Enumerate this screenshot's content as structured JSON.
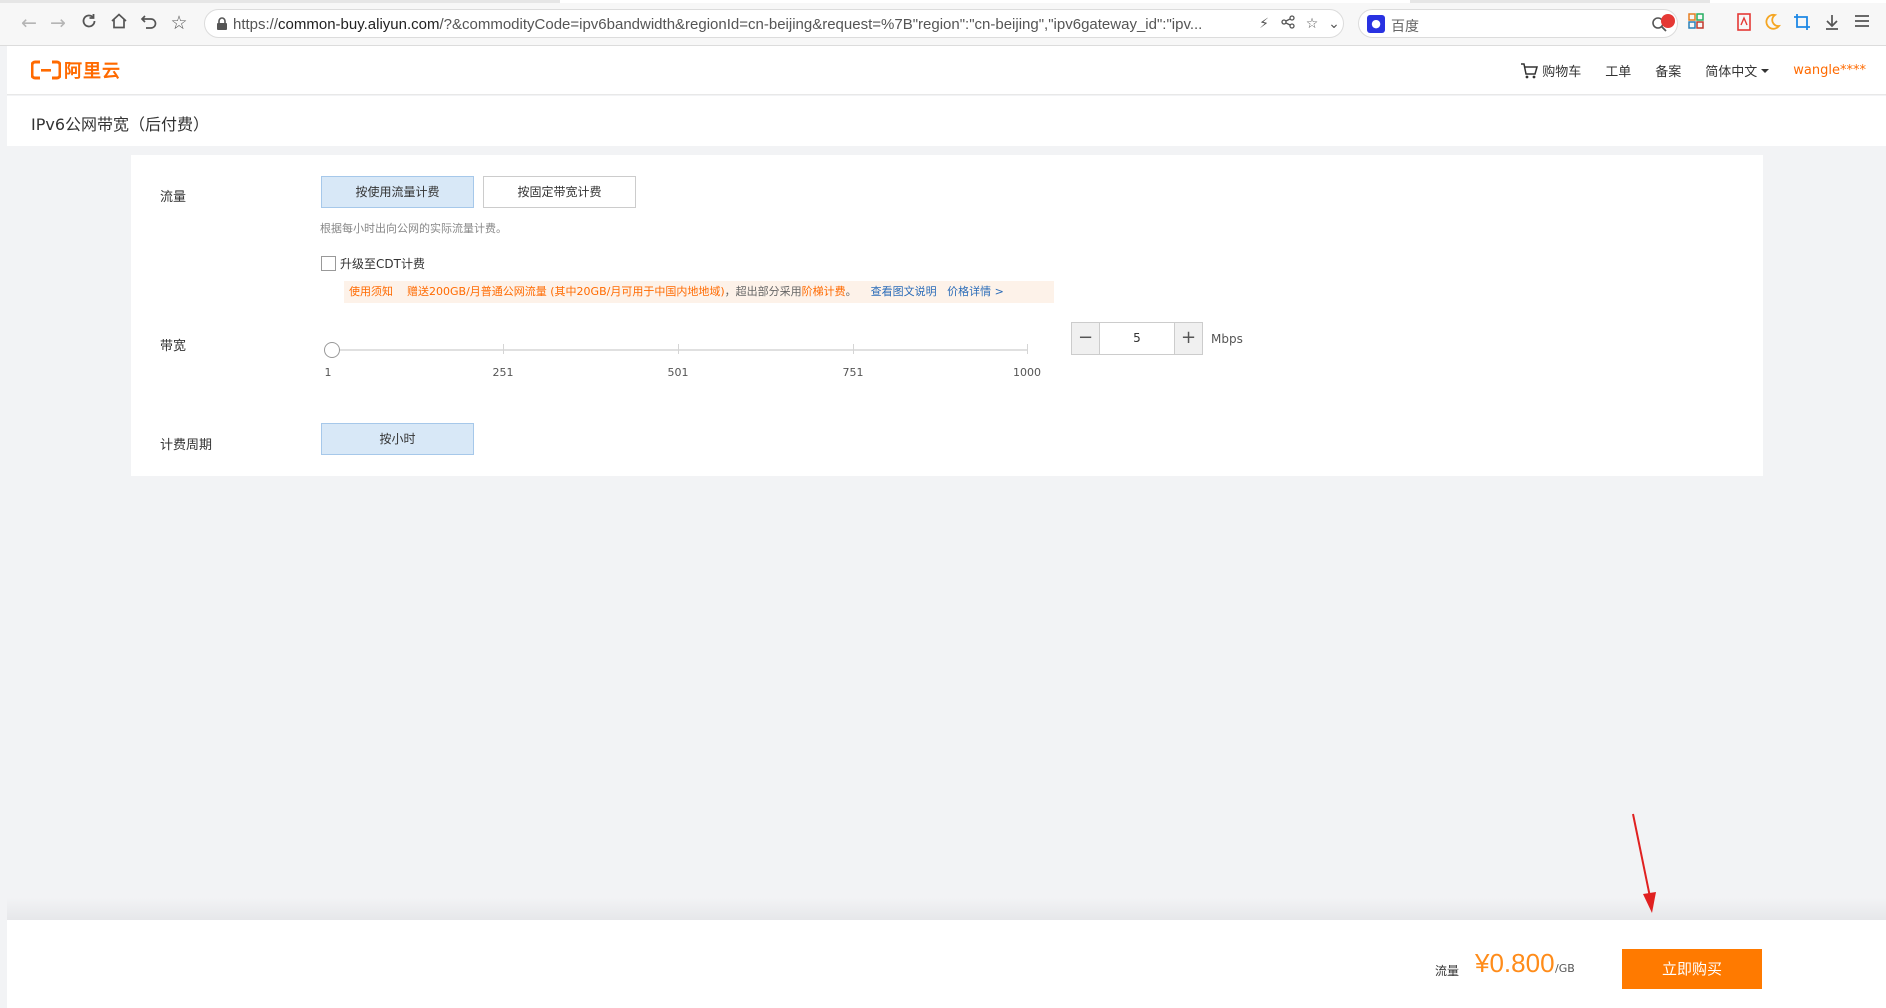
{
  "browser": {
    "url_prefix": "https://",
    "url_host": "common-buy.aliyun.com",
    "url_rest": "/?&commodityCode=ipv6bandwidth&regionId=cn-beijing&request=%7B\"region\":\"cn-beijing\",\"ipv6gateway_id\":\"ipv...",
    "search_engine": "百度"
  },
  "header": {
    "logo_text": "阿里云",
    "cart_label": "购物车",
    "ticket_label": "工单",
    "filing_label": "备案",
    "language_label": "简体中文",
    "user_label": "wangle****"
  },
  "page": {
    "title": "IPv6公网带宽（后付费）"
  },
  "traffic": {
    "label": "流量",
    "option_usage": "按使用流量计费",
    "option_fixed": "按固定带宽计费",
    "hint": "根据每小时出向公网的实际流量计费。",
    "cdt_label": "升级至CDT计费",
    "notice_title": "使用须知",
    "notice_gift": "赠送200GB/月普通公网流量 (其中20GB/月可用于中国内地地域)",
    "notice_mid": "，超出部分采用",
    "notice_tier": "阶梯计费",
    "notice_end": "。",
    "notice_link1": "查看图文说明",
    "notice_link2": "价格详情 >"
  },
  "bandwidth": {
    "label": "带宽",
    "ticks": [
      "1",
      "251",
      "501",
      "751",
      "1000"
    ],
    "value": "5",
    "unit": "Mbps",
    "slider_value": 5,
    "slider_min": 1,
    "slider_max": 1000
  },
  "billing": {
    "label": "计费周期",
    "option_hourly": "按小时"
  },
  "footer": {
    "price_label": "流量",
    "price": "¥0.800",
    "price_unit": "/GB",
    "buy_label": "立即购买"
  },
  "colors": {
    "brand": "#ff6a00",
    "buy_button": "#ff7a00",
    "selected_option": "#d8e8f7",
    "link": "#2b6cb8",
    "annotation_arrow": "#e02020"
  }
}
